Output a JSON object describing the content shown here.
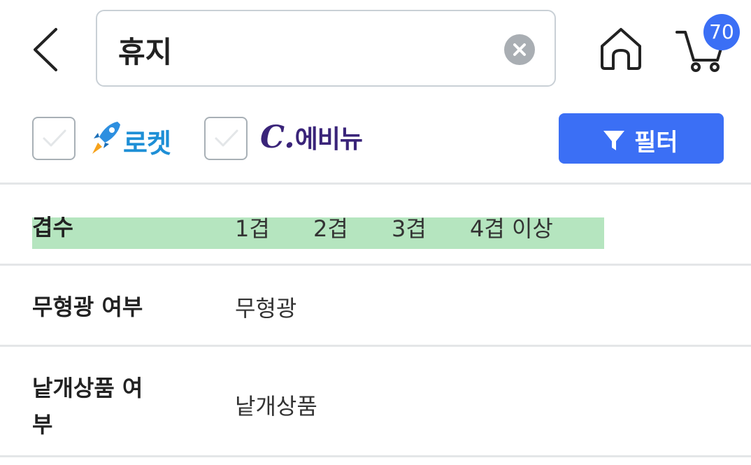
{
  "search": {
    "query": "휴지"
  },
  "cart": {
    "count": "70"
  },
  "filters": {
    "rocket_label": "로켓",
    "everynew_mark": "C.",
    "everynew_label": "에비뉴",
    "filter_button_label": "필터"
  },
  "rows": [
    {
      "label": "겹수",
      "options": [
        "1겹",
        "2겹",
        "3겹",
        "4겹 이상"
      ]
    },
    {
      "label": "무형광 여부",
      "options": [
        "무형광"
      ]
    },
    {
      "label_line1": "낱개상품 여",
      "label_line2": "부",
      "options": [
        "낱개상품"
      ]
    }
  ],
  "colors": {
    "accent": "#3b6ff5",
    "highlight": "#a8e0b4",
    "rocket_blue": "#1e8fd6",
    "everynew_purple": "#3a2479"
  }
}
